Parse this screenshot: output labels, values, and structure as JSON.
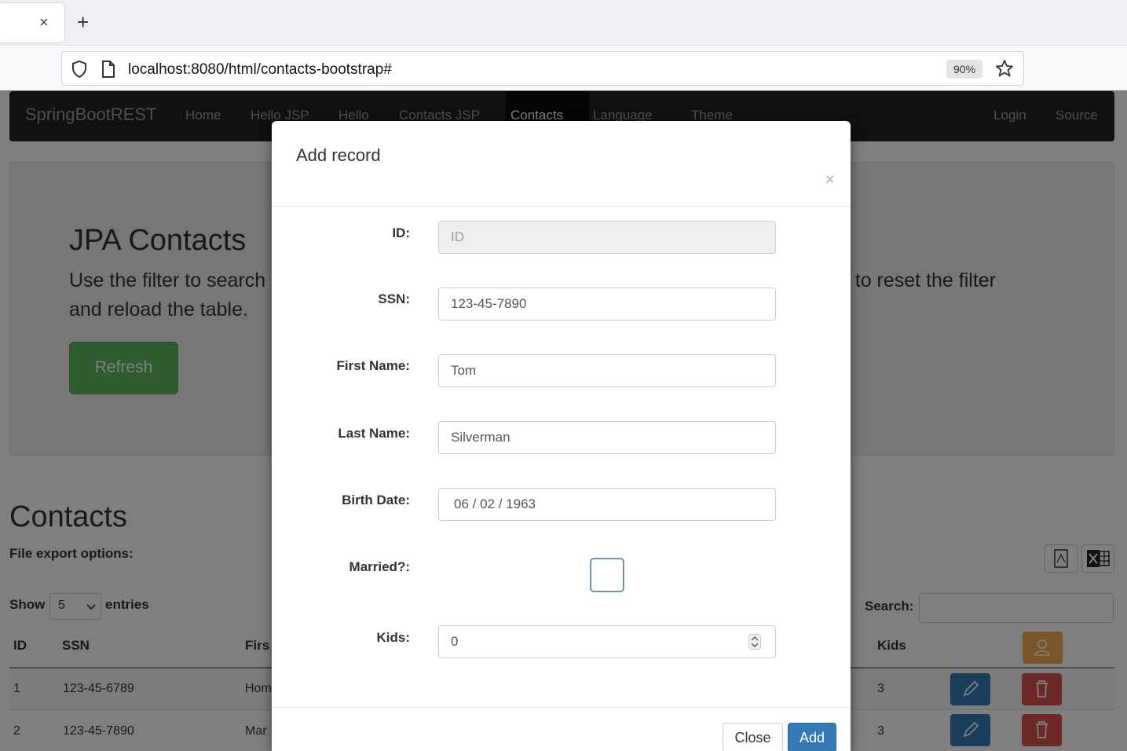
{
  "browser": {
    "tab_close": "×",
    "new_tab": "+",
    "url": "localhost:8080/html/contacts-bootstrap#",
    "zoom": "90%"
  },
  "app": {
    "brand": "SpringBootREST",
    "nav": [
      {
        "label": "Home"
      },
      {
        "label": "Hello JSP"
      },
      {
        "label": "Hello"
      },
      {
        "label": "Contacts JSP"
      },
      {
        "label": "Contacts"
      },
      {
        "label": "Language"
      },
      {
        "label": "Theme"
      },
      {
        "label": "Login"
      },
      {
        "label": "Source"
      }
    ],
    "jumbotron": {
      "title": "JPA Contacts",
      "text_left": "Use the filter to search",
      "text_line2": "and reload the table.",
      "text_right": "h' to reset the filter",
      "refresh_label": "Refresh"
    },
    "section_title": "Contacts",
    "export_label": "File export options:",
    "show_label": "Show",
    "show_value": "5",
    "entries_label": "entries",
    "search_label": "Search:",
    "table": {
      "headers": {
        "id": "ID",
        "ssn": "SSN",
        "first": "Firs",
        "kids": "Kids"
      },
      "rows": [
        {
          "id": "1",
          "ssn": "123-45-6789",
          "first": "Hom",
          "kids": "3"
        },
        {
          "id": "2",
          "ssn": "123-45-7890",
          "first": "Mar",
          "kids": "3"
        }
      ]
    }
  },
  "modal": {
    "title": "Add record",
    "close_x": "×",
    "fields": {
      "id_label": "ID:",
      "id_placeholder": "ID",
      "ssn_label": "SSN:",
      "ssn_value": "123-45-7890",
      "first_label": "First Name:",
      "first_value": "Tom",
      "last_label": "Last Name:",
      "last_value": "Silverman",
      "birth_label": "Birth Date:",
      "birth_value": "06 / 02 / 1963",
      "married_label": "Married?:",
      "married_checked": false,
      "kids_label": "Kids:",
      "kids_value": "0"
    },
    "close_label": "Close",
    "add_label": "Add"
  }
}
